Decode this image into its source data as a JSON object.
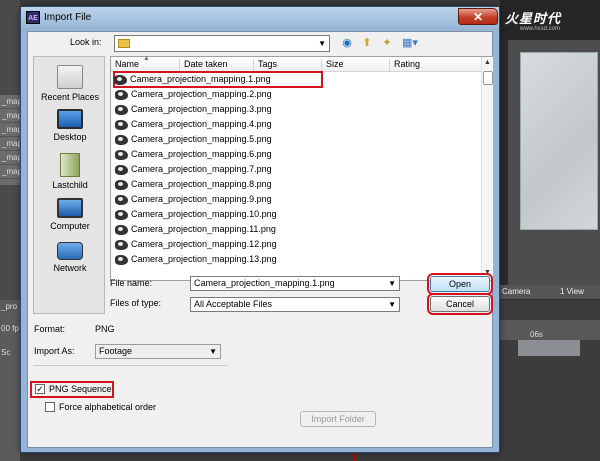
{
  "background": {
    "left_layer_items": [
      "_mapping",
      "_mappi",
      "_mappi",
      "_mappi",
      "_mappi",
      "_mappi"
    ],
    "left_lower": [
      "_pro",
      "00 fp",
      "Sc"
    ],
    "viewer_toolbar": [
      "Camera",
      "1 View"
    ],
    "timeline_marker": "06s",
    "brand": "火星时代",
    "brand_sub": "www.hxsd.com"
  },
  "dialog": {
    "title": "Import File",
    "app_icon": "AE",
    "look_in_label": "Look in:",
    "look_in_value": "",
    "nav_icons": [
      "back-icon",
      "up-folder-icon",
      "new-folder-icon",
      "views-menu-icon"
    ],
    "places": [
      {
        "label": "Recent Places",
        "icon": "recent-places-icon"
      },
      {
        "label": "Desktop",
        "icon": "desktop-icon"
      },
      {
        "label": "Lastchild",
        "icon": "user-folder-icon"
      },
      {
        "label": "Computer",
        "icon": "computer-icon"
      },
      {
        "label": "Network",
        "icon": "network-icon"
      }
    ],
    "columns": [
      "Name",
      "Date taken",
      "Tags",
      "Size",
      "Rating"
    ],
    "files": [
      "Camera_projection_mapping.1.png",
      "Camera_projection_mapping.2.png",
      "Camera_projection_mapping.3.png",
      "Camera_projection_mapping.4.png",
      "Camera_projection_mapping.5.png",
      "Camera_projection_mapping.6.png",
      "Camera_projection_mapping.7.png",
      "Camera_projection_mapping.8.png",
      "Camera_projection_mapping.9.png",
      "Camera_projection_mapping.10.png",
      "Camera_projection_mapping.11.png",
      "Camera_projection_mapping.12.png",
      "Camera_projection_mapping.13.png"
    ],
    "selected_file": "Camera_projection_mapping.1.png",
    "file_name_label": "File name:",
    "file_name_value": "Camera_projection_mapping.1.png",
    "files_of_type_label": "Files of type:",
    "files_of_type_value": "All Acceptable Files",
    "open_label": "Open",
    "cancel_label": "Cancel",
    "format_label": "Format:",
    "format_value": "PNG",
    "import_as_label": "Import As:",
    "import_as_value": "Footage",
    "png_sequence_label": "PNG Sequence",
    "png_sequence_checked": true,
    "force_alpha_label": "Force alphabetical order",
    "force_alpha_checked": false,
    "import_folder_label": "Import Folder",
    "close_glyph": "✕",
    "highlight_color": "#d3131f"
  }
}
